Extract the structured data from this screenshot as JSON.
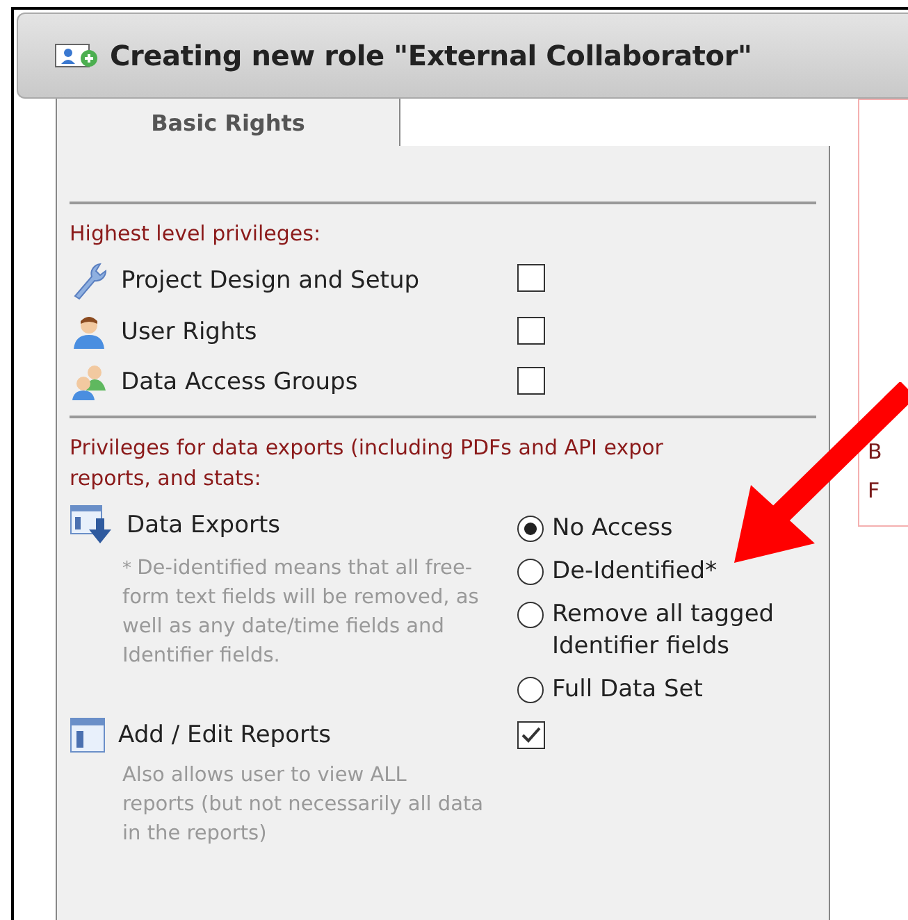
{
  "dialog": {
    "title": "Creating new role \"External Collaborator\"",
    "tabs": [
      {
        "label": "Basic Rights",
        "selected": true
      }
    ],
    "sections": [
      {
        "heading_lines": [
          "Highest level privileges:"
        ],
        "items": [
          {
            "kind": "checkbox",
            "label": "Project Design and Setup",
            "checked": false
          },
          {
            "kind": "checkbox",
            "label": "User Rights",
            "checked": false
          },
          {
            "kind": "checkbox",
            "label": "Data Access Groups",
            "checked": false
          }
        ]
      },
      {
        "heading_lines": [
          "Privileges for data exports (including PDFs and API expor",
          "reports, and stats:"
        ],
        "items": [
          {
            "kind": "radio",
            "label": "Data Exports",
            "note_mark": "*",
            "note": "De-identified means that all free-form text fields will be removed, as well as any date/time fields and Identifier fields.",
            "options": [
              {
                "label": "No Access",
                "selected": true
              },
              {
                "label": "De-Identified*",
                "selected": false
              },
              {
                "label": "Remove all tagged Identifier fields",
                "selected": false
              },
              {
                "label": "Full Data Set",
                "selected": false
              }
            ]
          },
          {
            "kind": "checkbox",
            "label": "Add / Edit Reports",
            "note": "Also allows user to view ALL reports (but not necessarily all data in the reports)",
            "checked": true
          }
        ]
      }
    ]
  },
  "side_panel": {
    "texts": [
      "B",
      "F"
    ]
  }
}
